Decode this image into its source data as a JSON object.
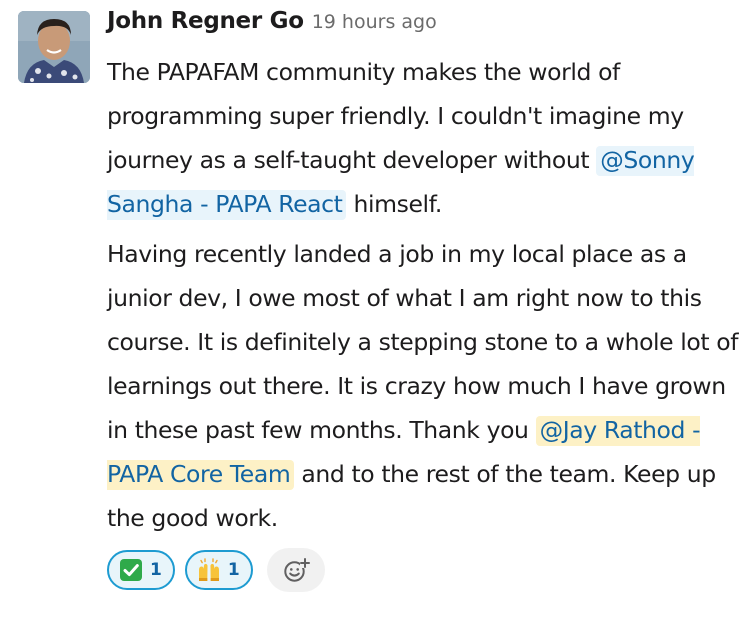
{
  "message": {
    "author": "John Regner Go",
    "time": "19 hours ago",
    "p1_text1": "The PAPAFAM community makes the world of programming super friendly. I couldn't imagine my journey as a self-taught developer without ",
    "p1_mention": "@Sonny Sangha - PAPA React",
    "p1_text2": " himself.",
    "p2_text1": "Having recently landed a job in my local place as a junior dev, I owe most of what I am right now to this course. It is definitely a stepping stone to a whole lot of learnings out there. It is crazy how much I have grown in these past few months. Thank you ",
    "p2_mention": "@Jay Rathod - PAPA Core Team",
    "p2_text2": " and to the rest of the team. Keep up the good work."
  },
  "reactions": [
    {
      "emoji": "white-check-mark",
      "count": "1"
    },
    {
      "emoji": "raised-hands",
      "count": "1"
    }
  ],
  "add_reaction_icon": "add-reaction-icon",
  "colors": {
    "mention_text": "#1264a3",
    "mention_bg": "#e8f4fb",
    "highlight_mention_bg": "#fdf1c6",
    "reaction_border": "#1d9bd1"
  }
}
